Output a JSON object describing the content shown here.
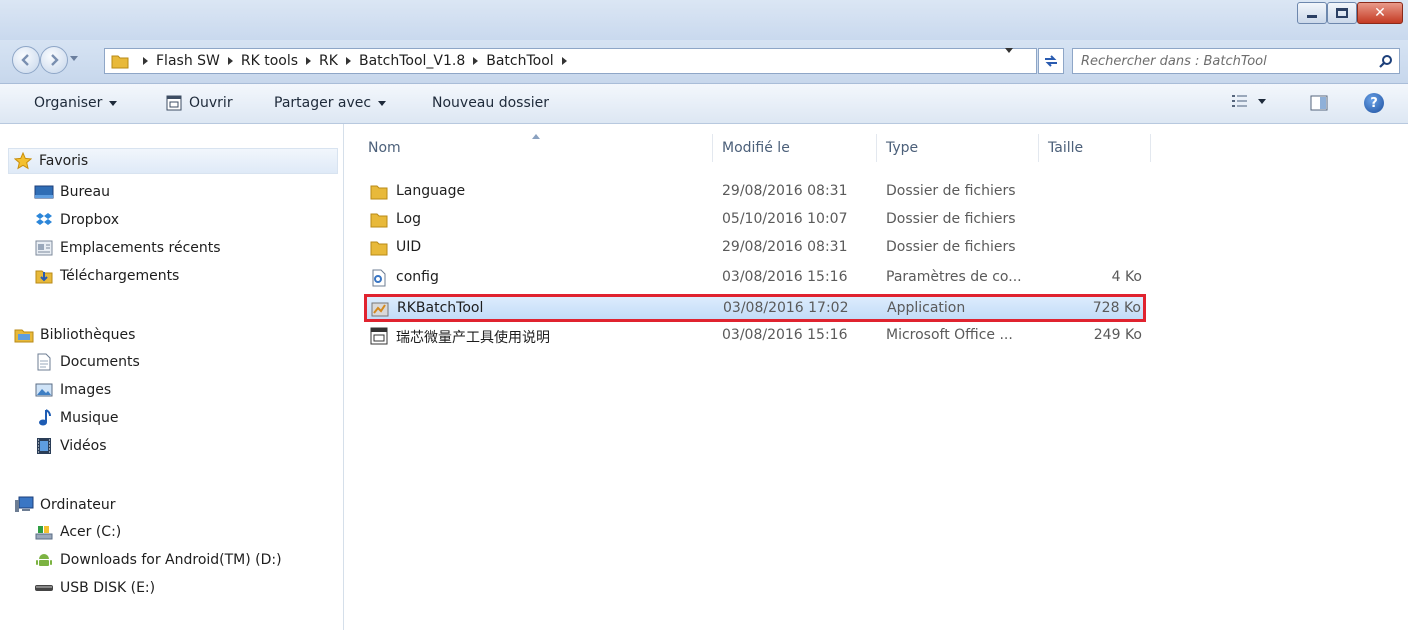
{
  "window": {
    "controls": {
      "minimize": "minimize",
      "maximize": "maximize",
      "close": "close"
    }
  },
  "address": {
    "breadcrumbs": [
      "Flash SW",
      "RK tools",
      "RK",
      "BatchTool_V1.8",
      "BatchTool"
    ],
    "search_placeholder": "Rechercher dans : BatchTool"
  },
  "toolbar": {
    "organise_label": "Organiser",
    "open_label": "Ouvrir",
    "share_label": "Partager avec",
    "new_folder_label": "Nouveau dossier"
  },
  "sidebar": {
    "favorites": {
      "title": "Favoris",
      "items": [
        "Bureau",
        "Dropbox",
        "Emplacements récents",
        "Téléchargements"
      ]
    },
    "libraries": {
      "title": "Bibliothèques",
      "items": [
        "Documents",
        "Images",
        "Musique",
        "Vidéos"
      ]
    },
    "computer": {
      "title": "Ordinateur",
      "items": [
        "Acer (C:)",
        "Downloads for Android(TM) (D:)",
        "USB DISK (E:)"
      ]
    }
  },
  "file_list": {
    "columns": {
      "name": "Nom",
      "modified": "Modifié le",
      "type": "Type",
      "size": "Taille"
    },
    "rows": [
      {
        "name": "Language",
        "modified": "29/08/2016 08:31",
        "type": "Dossier de fichiers",
        "size": "",
        "icon": "folder-icon"
      },
      {
        "name": "Log",
        "modified": "05/10/2016 10:07",
        "type": "Dossier de fichiers",
        "size": "",
        "icon": "folder-icon"
      },
      {
        "name": "UID",
        "modified": "29/08/2016 08:31",
        "type": "Dossier de fichiers",
        "size": "",
        "icon": "folder-icon"
      },
      {
        "name": "config",
        "modified": "03/08/2016 15:16",
        "type": "Paramètres de co...",
        "size": "4 Ko",
        "icon": "config-file-icon"
      },
      {
        "name": "RKBatchTool",
        "modified": "03/08/2016 17:02",
        "type": "Application",
        "size": "728 Ko",
        "icon": "application-icon",
        "selected": true
      },
      {
        "name": "瑞芯微量产工具使用说明",
        "modified": "03/08/2016 15:16",
        "type": "Microsoft Office ...",
        "size": "249 Ko",
        "icon": "office-document-icon"
      }
    ]
  },
  "colors": {
    "highlight_border": "#e0232f",
    "selection_fill": "#cde4fb"
  }
}
